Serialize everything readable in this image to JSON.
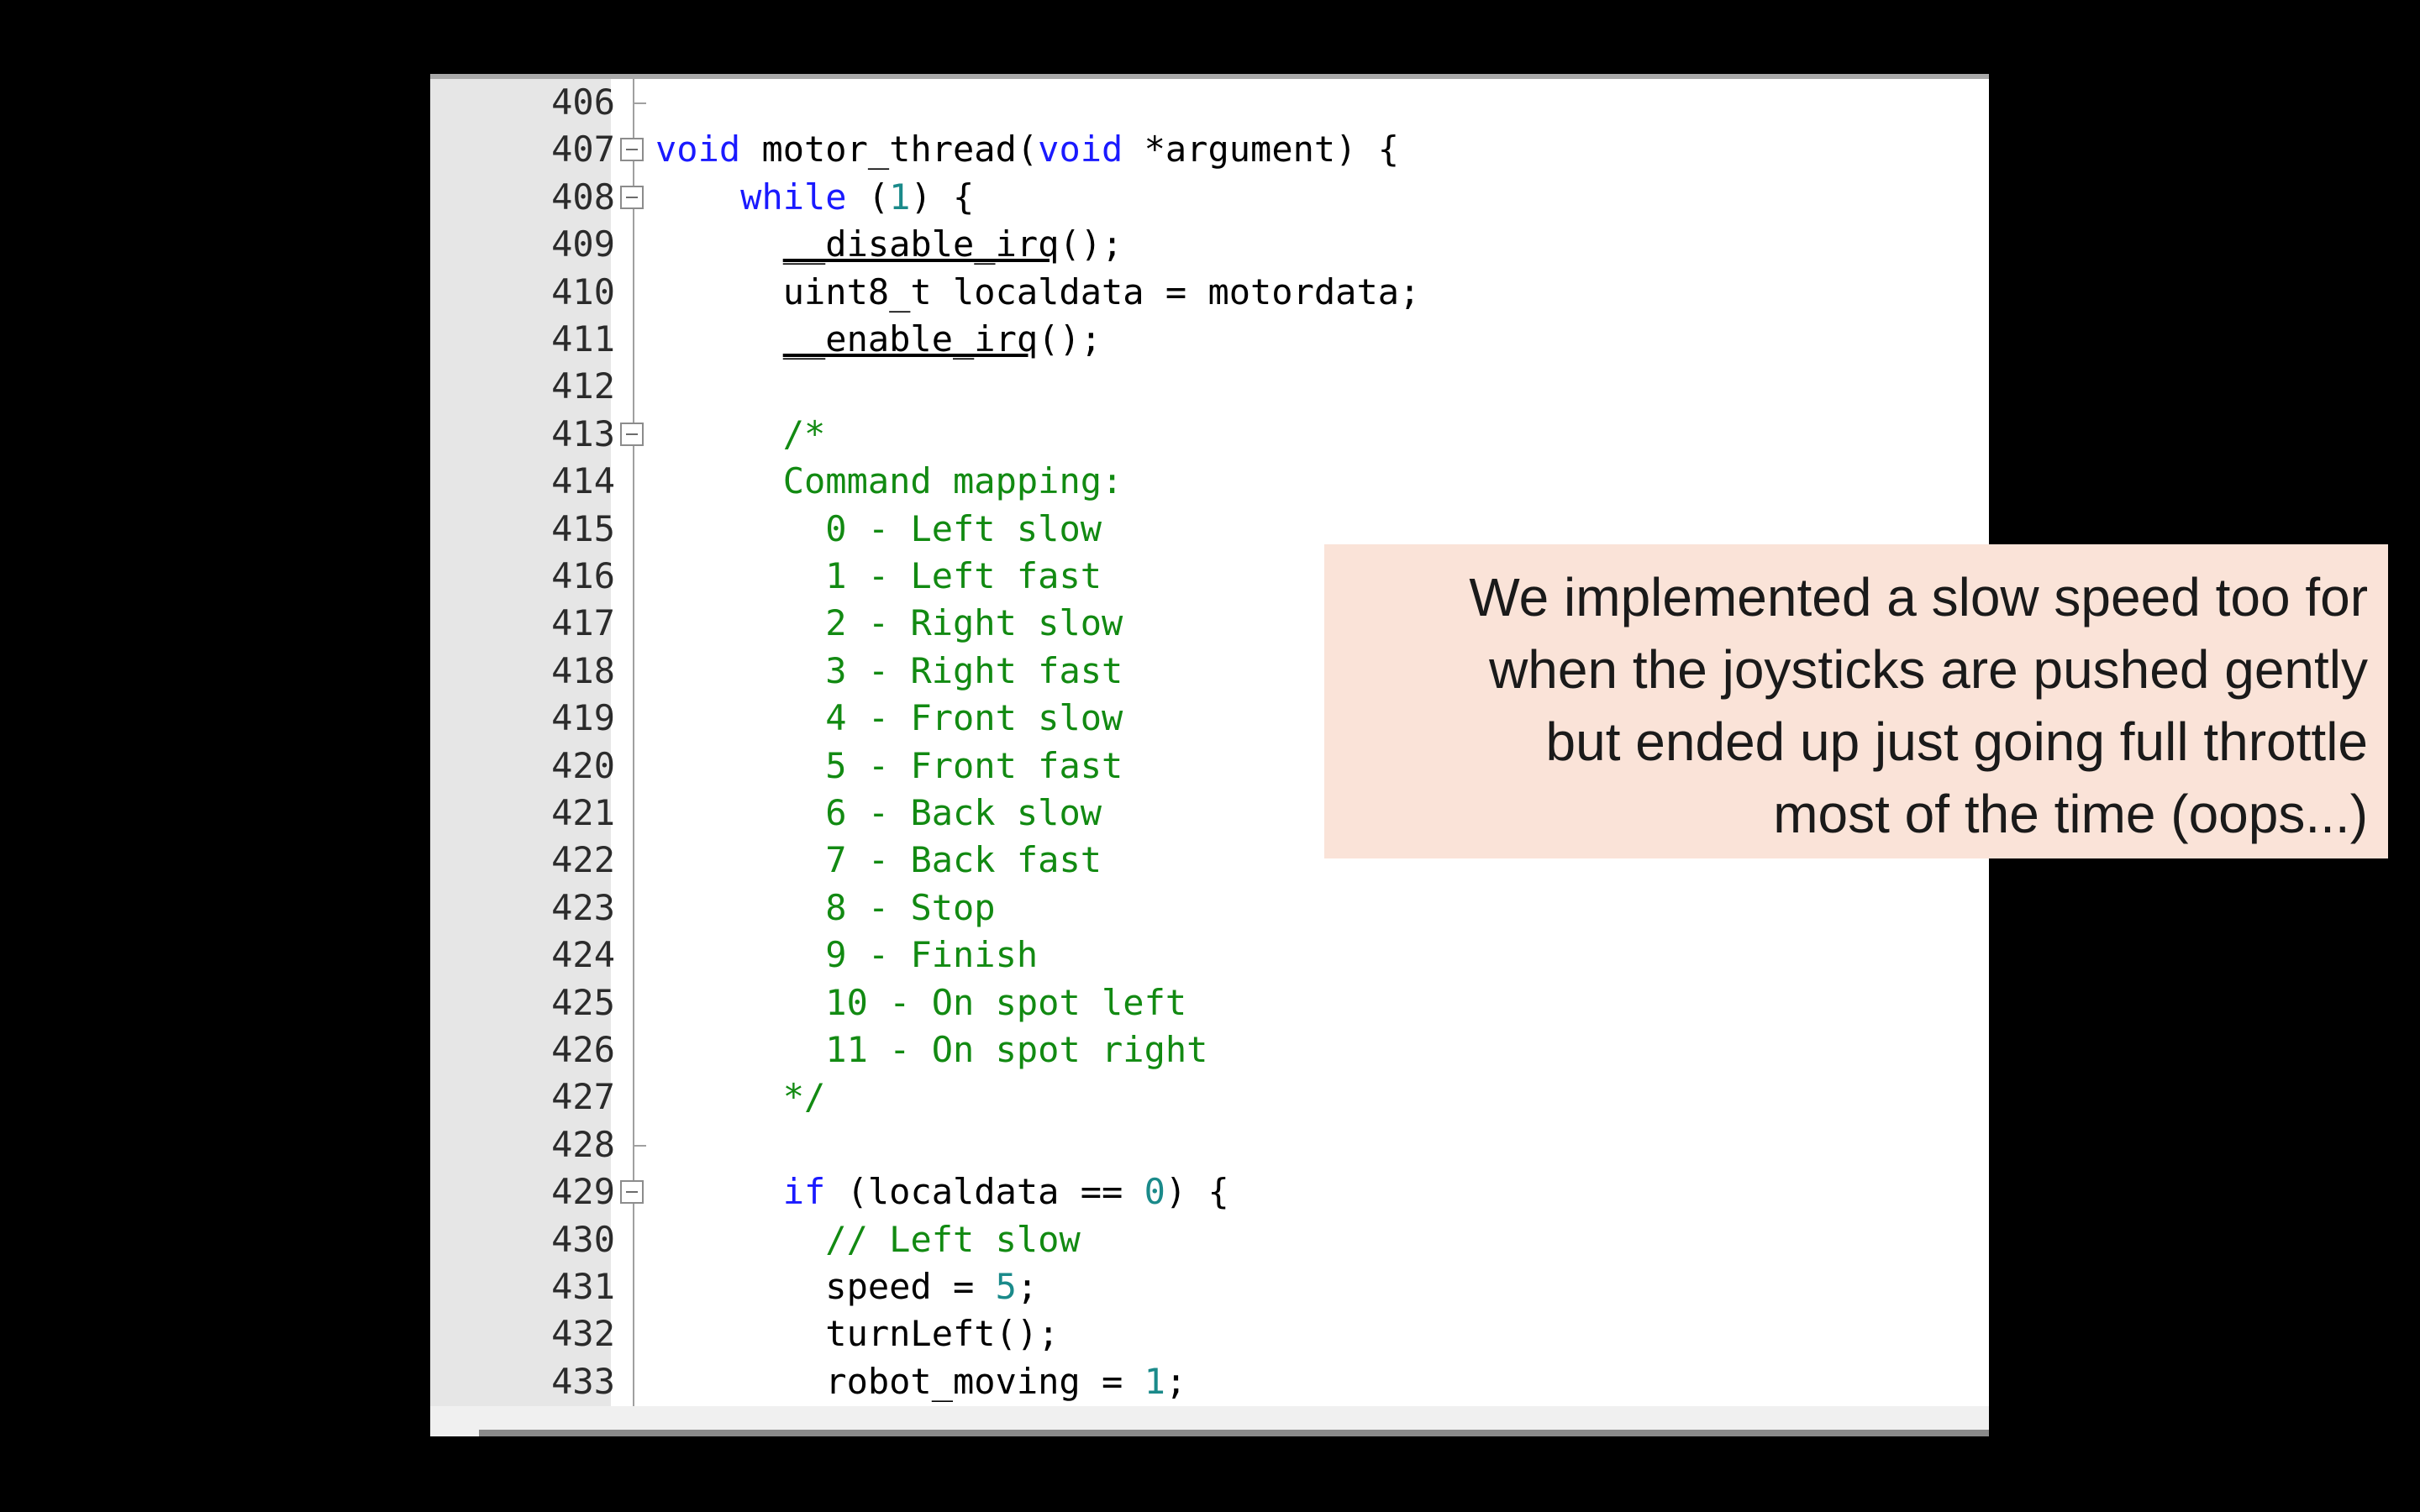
{
  "editor": {
    "lines": [
      {
        "n": "406",
        "fold": "end",
        "parts": []
      },
      {
        "n": "407",
        "fold": "box",
        "parts": [
          {
            "t": "void",
            "c": "kw"
          },
          {
            "t": " motor_thread("
          },
          {
            "t": "void",
            "c": "kw"
          },
          {
            "t": " *argument) {"
          }
        ]
      },
      {
        "n": "408",
        "fold": "box",
        "parts": [
          {
            "t": "    "
          },
          {
            "t": "while",
            "c": "kw"
          },
          {
            "t": " ("
          },
          {
            "t": "1",
            "c": "num"
          },
          {
            "t": ") {"
          }
        ]
      },
      {
        "n": "409",
        "fold": "",
        "parts": [
          {
            "t": "      "
          },
          {
            "t": "__disable_irq",
            "c": "ul"
          },
          {
            "t": "();"
          }
        ]
      },
      {
        "n": "410",
        "fold": "",
        "parts": [
          {
            "t": "      uint8_t localdata = motordata;"
          }
        ]
      },
      {
        "n": "411",
        "fold": "",
        "parts": [
          {
            "t": "      "
          },
          {
            "t": "__enable_irq",
            "c": "ul"
          },
          {
            "t": "();"
          }
        ]
      },
      {
        "n": "412",
        "fold": "",
        "parts": []
      },
      {
        "n": "413",
        "fold": "box",
        "parts": [
          {
            "t": "      "
          },
          {
            "t": "/*",
            "c": "cm"
          }
        ]
      },
      {
        "n": "414",
        "fold": "",
        "parts": [
          {
            "t": "      "
          },
          {
            "t": "Command mapping:",
            "c": "cm"
          }
        ]
      },
      {
        "n": "415",
        "fold": "",
        "parts": [
          {
            "t": "        "
          },
          {
            "t": "0 - Left slow",
            "c": "cm"
          }
        ]
      },
      {
        "n": "416",
        "fold": "",
        "parts": [
          {
            "t": "        "
          },
          {
            "t": "1 - Left fast",
            "c": "cm"
          }
        ]
      },
      {
        "n": "417",
        "fold": "",
        "parts": [
          {
            "t": "        "
          },
          {
            "t": "2 - Right slow",
            "c": "cm"
          }
        ]
      },
      {
        "n": "418",
        "fold": "",
        "parts": [
          {
            "t": "        "
          },
          {
            "t": "3 - Right fast",
            "c": "cm"
          }
        ]
      },
      {
        "n": "419",
        "fold": "",
        "parts": [
          {
            "t": "        "
          },
          {
            "t": "4 - Front slow",
            "c": "cm"
          }
        ]
      },
      {
        "n": "420",
        "fold": "",
        "parts": [
          {
            "t": "        "
          },
          {
            "t": "5 - Front fast",
            "c": "cm"
          }
        ]
      },
      {
        "n": "421",
        "fold": "",
        "parts": [
          {
            "t": "        "
          },
          {
            "t": "6 - Back slow",
            "c": "cm"
          }
        ]
      },
      {
        "n": "422",
        "fold": "",
        "parts": [
          {
            "t": "        "
          },
          {
            "t": "7 - Back fast",
            "c": "cm"
          }
        ]
      },
      {
        "n": "423",
        "fold": "",
        "parts": [
          {
            "t": "        "
          },
          {
            "t": "8 - Stop",
            "c": "cm"
          }
        ]
      },
      {
        "n": "424",
        "fold": "",
        "parts": [
          {
            "t": "        "
          },
          {
            "t": "9 - Finish",
            "c": "cm"
          }
        ]
      },
      {
        "n": "425",
        "fold": "",
        "parts": [
          {
            "t": "        "
          },
          {
            "t": "10 - On spot left",
            "c": "cm"
          }
        ]
      },
      {
        "n": "426",
        "fold": "",
        "parts": [
          {
            "t": "        "
          },
          {
            "t": "11 - On spot right",
            "c": "cm"
          }
        ]
      },
      {
        "n": "427",
        "fold": "",
        "parts": [
          {
            "t": "      "
          },
          {
            "t": "*/",
            "c": "cm"
          }
        ]
      },
      {
        "n": "428",
        "fold": "end",
        "parts": []
      },
      {
        "n": "429",
        "fold": "box",
        "parts": [
          {
            "t": "      "
          },
          {
            "t": "if",
            "c": "kw"
          },
          {
            "t": " (localdata == "
          },
          {
            "t": "0",
            "c": "num"
          },
          {
            "t": ") {"
          }
        ]
      },
      {
        "n": "430",
        "fold": "",
        "parts": [
          {
            "t": "        "
          },
          {
            "t": "// Left slow",
            "c": "cm"
          }
        ]
      },
      {
        "n": "431",
        "fold": "",
        "parts": [
          {
            "t": "        speed = "
          },
          {
            "t": "5",
            "c": "num"
          },
          {
            "t": ";"
          }
        ]
      },
      {
        "n": "432",
        "fold": "",
        "parts": [
          {
            "t": "        turnLeft();"
          }
        ]
      },
      {
        "n": "433",
        "fold": "",
        "parts": [
          {
            "t": "        robot_moving = "
          },
          {
            "t": "1",
            "c": "num"
          },
          {
            "t": ";"
          }
        ]
      }
    ]
  },
  "callout": {
    "lines": [
      "We implemented a slow speed too for",
      "when the joysticks are pushed gently",
      "but ended up just going full throttle",
      "most of the time (oops...)"
    ]
  },
  "colors": {
    "background": "#000000",
    "keyword": "#1a1aff",
    "comment": "#128a12",
    "number": "#1a8a8a",
    "callout_bg": "#fae3d8"
  }
}
